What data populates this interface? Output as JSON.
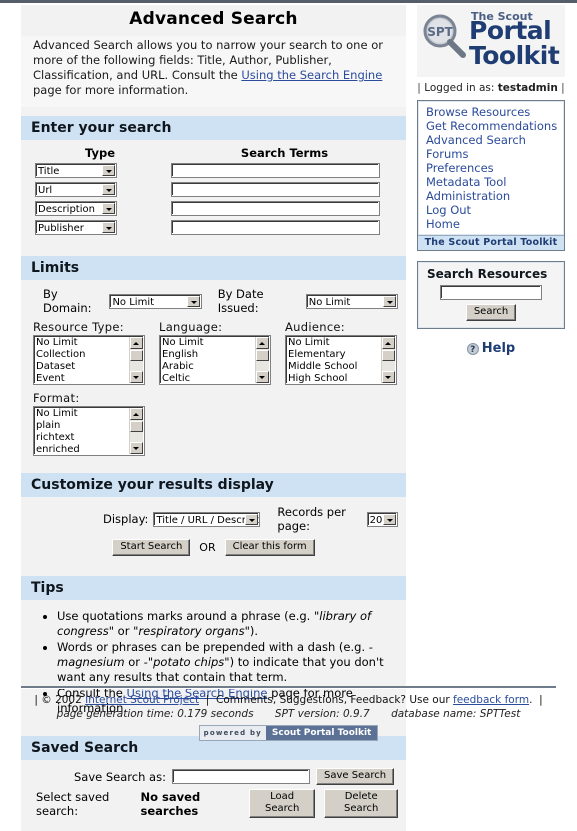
{
  "page": {
    "title": "Advanced Search",
    "intro": "Advanced Search allows you to narrow your search to one or more of the following fields: Title, Author, Publisher, Classification, and URL. Consult the ",
    "intro_link": "Using the Search Engine",
    "intro_tail": " page for more information."
  },
  "enter_search": {
    "heading": "Enter your search",
    "col_type": "Type",
    "col_terms": "Search Terms",
    "rows": [
      {
        "type": "Title",
        "term": ""
      },
      {
        "type": "Url",
        "term": ""
      },
      {
        "type": "Description",
        "term": ""
      },
      {
        "type": "Publisher",
        "term": ""
      }
    ]
  },
  "limits": {
    "heading": "Limits",
    "by_domain_label": "By Domain:",
    "by_domain_value": "No Limit",
    "by_date_label": "By Date Issued:",
    "by_date_value": "No Limit",
    "lists": [
      {
        "label": "Resource Type:",
        "options": [
          "No Limit",
          "Collection",
          "Dataset",
          "Event"
        ]
      },
      {
        "label": "Language:",
        "options": [
          "No Limit",
          "English",
          "Arabic",
          "Celtic"
        ]
      },
      {
        "label": "Audience:",
        "options": [
          "No Limit",
          "Elementary",
          "Middle School",
          "High School"
        ]
      }
    ],
    "format": {
      "label": "Format:",
      "options": [
        "No Limit",
        "plain",
        "richtext",
        "enriched"
      ]
    }
  },
  "customize": {
    "heading": "Customize your results display",
    "display_label": "Display:",
    "display_value": "Title / URL / Description",
    "records_label": "Records per page:",
    "records_value": "20",
    "start_button": "Start Search",
    "or_text": "OR",
    "clear_button": "Clear this form"
  },
  "tips": {
    "heading": "Tips",
    "items": [
      {
        "pre": "Use quotations marks around a phrase (e.g. ",
        "em1": "\"library of congress\"",
        "mid": " or ",
        "em2": "\"respiratory organs\"",
        "post": ")."
      },
      {
        "pre": "Words or phrases can be prepended with a dash (e.g. ",
        "em1": "-magnesium",
        "mid": " or ",
        "em2": "-\"potato chips\"",
        "post": ") to indicate that you don't want any results that contain that term."
      },
      {
        "pre": "Consult the ",
        "link": "Using the Search Engine",
        "post": " page for more information."
      }
    ]
  },
  "saved_search": {
    "heading": "Saved Search",
    "save_as_label": "Save Search as:",
    "save_as_value": "",
    "save_button": "Save Search",
    "select_label": "Select saved search:",
    "no_saved_text": "No saved searches",
    "load_button": "Load Search",
    "delete_button": "Delete Search"
  },
  "sidebar": {
    "logo": {
      "scout": "The Scout",
      "portal": "Portal",
      "toolkit": "Toolkit",
      "mag_text": "SPT"
    },
    "logged_in_prefix": "Logged in as:",
    "logged_in_user": "testadmin",
    "nav_items": [
      "Browse Resources",
      "Get Recommendations",
      "Advanced Search",
      "Forums",
      "Preferences",
      "Metadata Tool",
      "Administration",
      "Log Out",
      "Home"
    ],
    "nav_footer": "The Scout Portal Toolkit",
    "search_box": {
      "heading": "Search Resources",
      "value": "",
      "button": "Search"
    },
    "help_label": "Help",
    "help_icon": "?"
  },
  "footer": {
    "copyright": "© 2002",
    "org_link": "Internet Scout Project",
    "feedback_pre": "Comments, Suggestions, Feedback? Use our ",
    "feedback_link": "feedback form",
    "feedback_post": ".",
    "gen_time": "page generation time: 0.179 seconds",
    "version": "SPT version: 0.9.7",
    "database": "database name: SPTTest",
    "powered_by": "powered by",
    "powered_name": "Scout Portal Toolkit"
  },
  "colors": {
    "section_header_bg": "#cfe2f3",
    "link": "#2b4b9b",
    "logo_blue": "#1f3d73",
    "page_bg": "#f2f2f2"
  }
}
